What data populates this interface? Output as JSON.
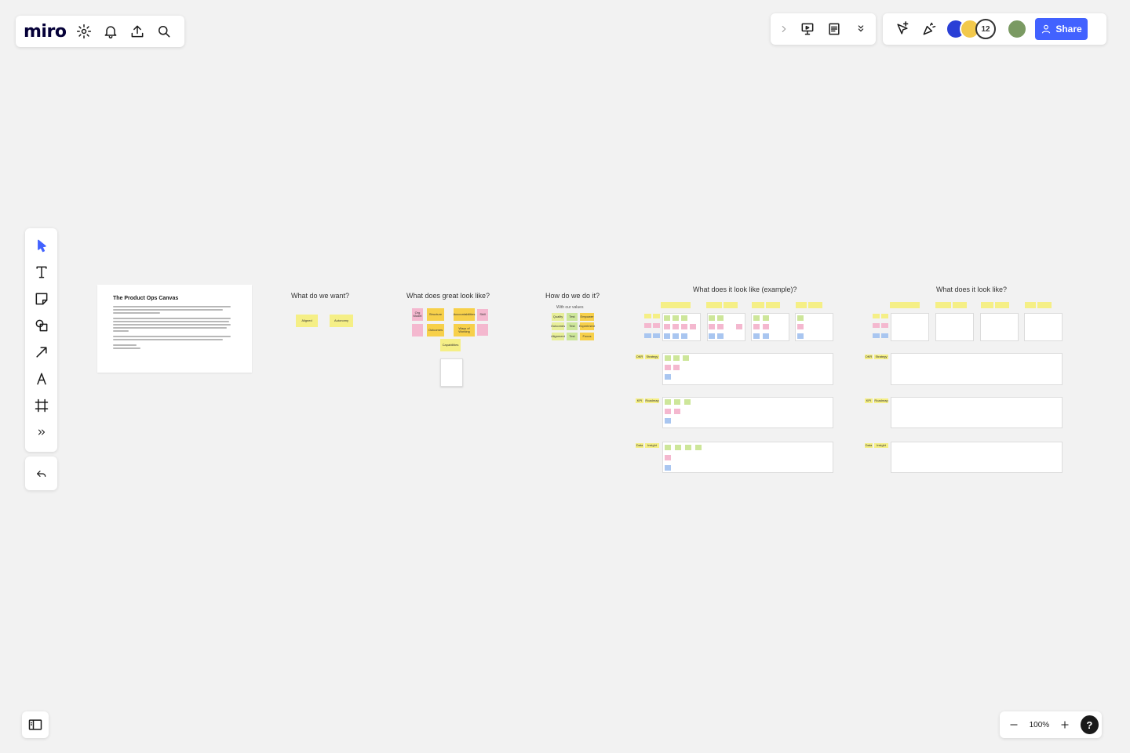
{
  "app": {
    "logo": "miro"
  },
  "top_left": {
    "icons": [
      "settings-icon",
      "bell-icon",
      "upload-icon",
      "search-icon"
    ]
  },
  "top_right": {
    "avatar_count": "12",
    "share_label": "Share"
  },
  "toolbar": {
    "icons": [
      "cursor-icon",
      "text-icon",
      "sticky-note-icon",
      "shapes-icon",
      "arrow-icon",
      "pen-icon",
      "frame-icon",
      "more-icon"
    ]
  },
  "zoom": {
    "level": "100%",
    "help": "?"
  },
  "canvas": {
    "doc": {
      "title": "The Product Ops Canvas"
    },
    "sections": {
      "want": "What do we want?",
      "great": "What does great look like?",
      "how": "How do we do it?",
      "how_sub": "With our values",
      "example": "What does it look like (example)?",
      "blank": "What does it look like?"
    },
    "want_stickies": [
      "Aligned",
      "Autonomy"
    ],
    "great_stickies": {
      "org_model": "Org Model",
      "structure": "Structure",
      "accountabilities": "Accountabilities",
      "ways": "Ways of Working",
      "capabilities": "Capabilities",
      "outcomes": "Outcomes",
      "skill": "Skill"
    },
    "how_rows": [
      {
        "label": "Quality",
        "a": "Test",
        "b": "Empower"
      },
      {
        "label": "Outcomes",
        "a": "Test",
        "b": "Experiment"
      },
      {
        "label": "Alignment",
        "a": "Test",
        "b": "Focus"
      }
    ],
    "example_rows": [
      "OKR",
      "KPI",
      "Data"
    ],
    "example_headers": [
      "Strategy",
      "Roadmap",
      "Insight"
    ]
  }
}
